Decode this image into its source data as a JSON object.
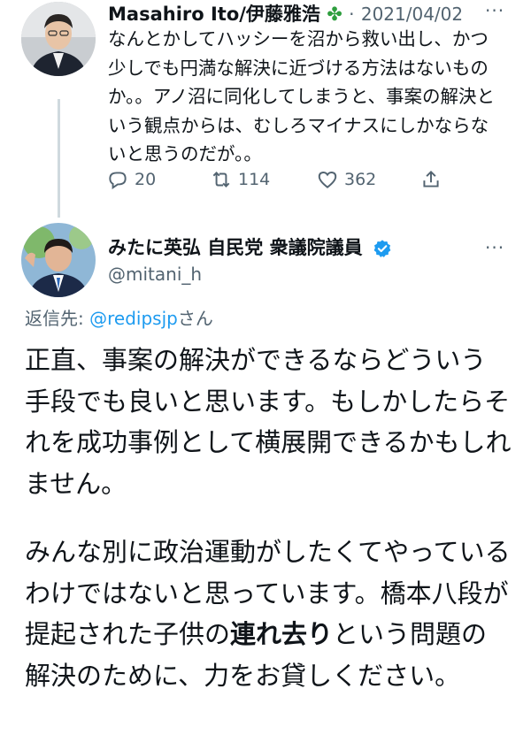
{
  "tweet1": {
    "display_name": "Masahiro Ito/伊藤雅浩",
    "badge_icon": "four-leaf-clover",
    "separator": "·",
    "date": "2021/04/02",
    "more": "···",
    "text": "なんとかしてハッシーを沼から救い出し、かつ少しでも円満な解決に近づける方法はないものか。。アノ沼に同化してしまうと、事案の解決という観点からは、むしろマイナスにしかならないと思うのだが。。",
    "actions": {
      "reply_count": "20",
      "retweet_count": "114",
      "like_count": "362"
    }
  },
  "tweet2": {
    "display_name": "みたに英弘 自民党 衆議院議員",
    "verified": true,
    "handle": "@mitani_h",
    "more": "···",
    "reply_label": "返信先: ",
    "reply_mention": "@redipsjp",
    "reply_suffix": "さん",
    "paragraph1": "正直、事案の解決ができるならどういう手段でも良いと思います。もしかしたらそれを成功事例として横展開できるかもしれません。",
    "paragraph2_part1": "みんな別に政治運動がしたくてやっているわけではないと思っています。橋本八段が提起された子供の",
    "paragraph2_bold": "連れ去り",
    "paragraph2_part2": "という問題の解決のために、力をお貸しください。"
  },
  "colors": {
    "text": "#0f1419",
    "secondary": "#536471",
    "link": "#1d9bf0",
    "thread_line": "#cfd9de",
    "clover": "#2e9e3e"
  }
}
